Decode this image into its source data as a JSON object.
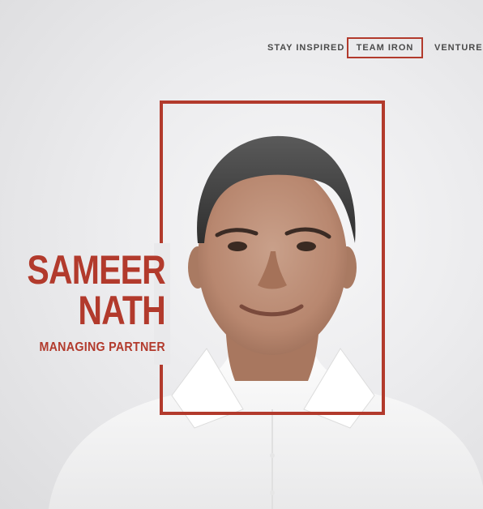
{
  "nav": {
    "items": [
      {
        "label": "STAY INSPIRED",
        "active": false
      },
      {
        "label": "TEAM IRON",
        "active": true
      },
      {
        "label": "VENTURES",
        "active": false
      }
    ]
  },
  "profile": {
    "first_name": "SAMEER",
    "last_name": "NATH",
    "title": "MANAGING PARTNER"
  },
  "colors": {
    "accent": "#b23a2c",
    "nav_text": "#4a4a4a",
    "background": "#e9e9eb"
  }
}
